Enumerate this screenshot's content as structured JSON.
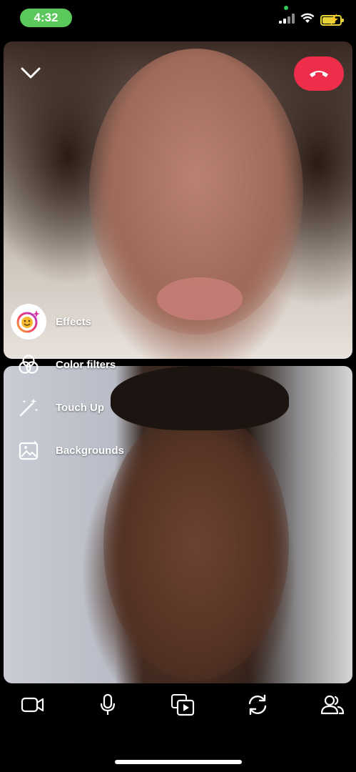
{
  "status_bar": {
    "time": "4:32",
    "time_pill_color": "#5ac85a",
    "icons": [
      "signal-icon",
      "wifi-icon",
      "battery-charging-icon"
    ],
    "battery_level": 0.7
  },
  "call": {
    "end_call_color": "#ee2d4a",
    "controls": [
      "collapse-icon",
      "end-call-icon"
    ]
  },
  "effects_menu": {
    "items": [
      {
        "label": "Effects",
        "icon": "effects-face-icon"
      },
      {
        "label": "Color filters",
        "icon": "color-filters-icon"
      },
      {
        "label": "Touch Up",
        "icon": "magic-wand-icon"
      },
      {
        "label": "Backgrounds",
        "icon": "backgrounds-icon"
      }
    ]
  },
  "bottom_bar": {
    "icons": [
      "video-camera-icon",
      "microphone-icon",
      "share-media-icon",
      "flip-camera-icon",
      "participants-icon"
    ]
  }
}
